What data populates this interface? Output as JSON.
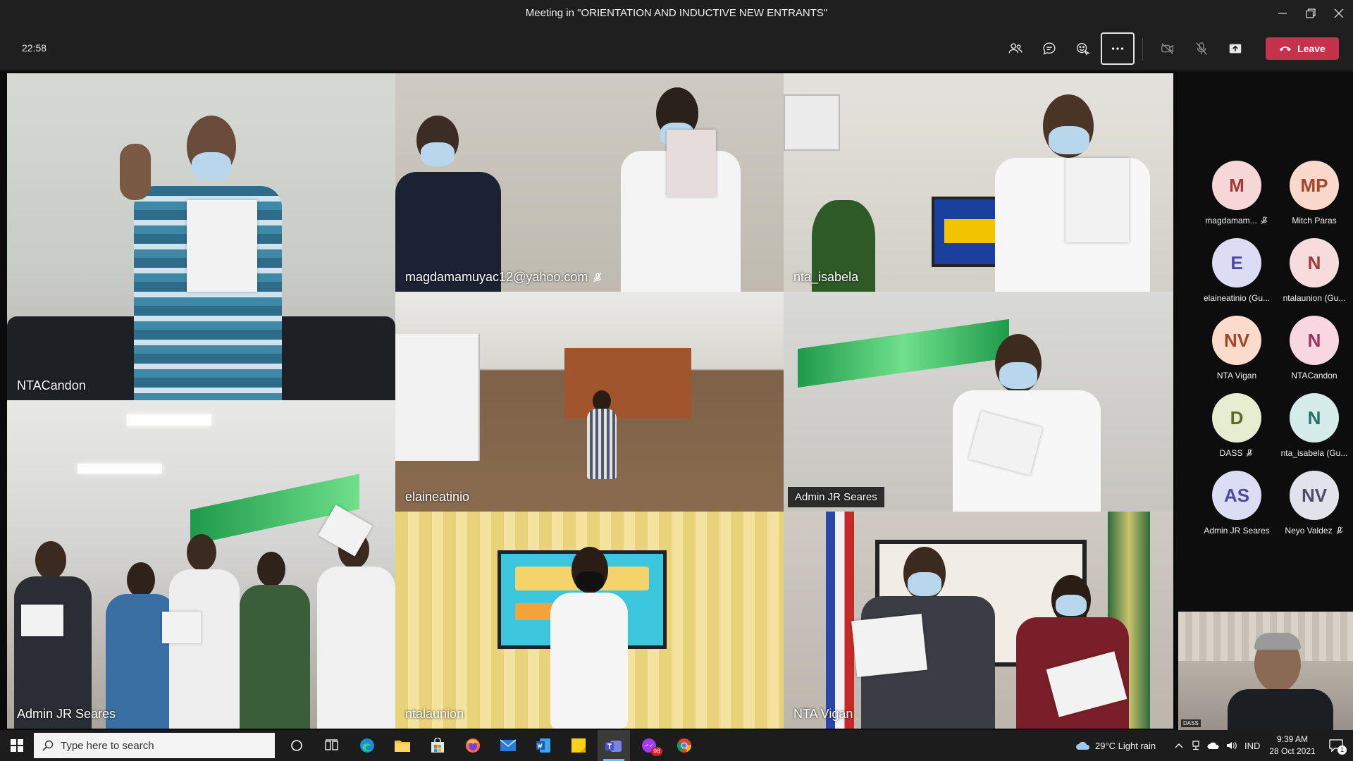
{
  "window": {
    "title": "Meeting in \"ORIENTATION AND INDUCTIVE NEW ENTRANTS\"",
    "controls": [
      "minimize-icon",
      "restore-icon",
      "close-icon"
    ]
  },
  "toolbar": {
    "timer": "22:58",
    "buttons": [
      "people-icon",
      "chat-icon",
      "reactions-icon",
      "more-icon",
      "camera-off-icon",
      "mic-off-icon",
      "share-icon"
    ],
    "leave_label": "Leave",
    "leave_color": "#c4314b"
  },
  "tiles": [
    {
      "name": "NTACandon"
    },
    {
      "name": "magdamamuyac12@yahoo.com",
      "muted": true
    },
    {
      "name": "nta_isabela"
    },
    {
      "name": "elaineatinio"
    },
    {
      "name": "Admin JR Seares"
    },
    {
      "name": "Admin JR Seares"
    },
    {
      "name": "ntalaunion"
    },
    {
      "name": "NTA Vigan"
    }
  ],
  "participants": [
    {
      "initials": "M",
      "name": "magdamam...",
      "muted": true,
      "color": "#f6d6d6",
      "text_color": "#a13a3a"
    },
    {
      "initials": "MP",
      "name": "Mitch Paras",
      "muted": false,
      "color": "#fbd8cc",
      "text_color": "#a2462a"
    },
    {
      "initials": "E",
      "name": "elaineatinio (Gu...",
      "muted": false,
      "color": "#dcdcf5",
      "text_color": "#4b4ba0"
    },
    {
      "initials": "N",
      "name": "ntalaunion (Gu...",
      "muted": false,
      "color": "#f6dcdc",
      "text_color": "#a13a3a"
    },
    {
      "initials": "NV",
      "name": "NTA Vigan",
      "muted": false,
      "color": "#fbdccc",
      "text_color": "#a2462a"
    },
    {
      "initials": "N",
      "name": "NTACandon",
      "muted": false,
      "color": "#f8d6e2",
      "text_color": "#a1345e"
    },
    {
      "initials": "D",
      "name": "DASS",
      "muted": true,
      "color": "#e6ecd0",
      "text_color": "#5a6a24"
    },
    {
      "initials": "N",
      "name": "nta_isabela (Gu...",
      "muted": false,
      "color": "#d6ecea",
      "text_color": "#24706a"
    },
    {
      "initials": "AS",
      "name": "Admin JR Seares",
      "muted": false,
      "color": "#dcdcf5",
      "text_color": "#4b4ba0"
    },
    {
      "initials": "NV",
      "name": "Neyo Valdez",
      "muted": true,
      "color": "#e2e2ec",
      "text_color": "#4c4c66"
    }
  ],
  "self_view": {
    "label": "DASS"
  },
  "taskbar": {
    "search_placeholder": "Type here to search",
    "weather": "29°C  Light rain",
    "language": "IND",
    "time": "9:39 AM",
    "date": "28 Oct 2021",
    "teams_badge": "98",
    "notification_count": "1",
    "apps": [
      "cortana-icon",
      "task-view-icon",
      "edge-icon",
      "file-explorer-icon",
      "store-icon",
      "firefox-icon",
      "mail-icon",
      "word-icon",
      "sticky-notes-icon",
      "teams-icon",
      "messenger-icon",
      "chrome-icon"
    ]
  }
}
